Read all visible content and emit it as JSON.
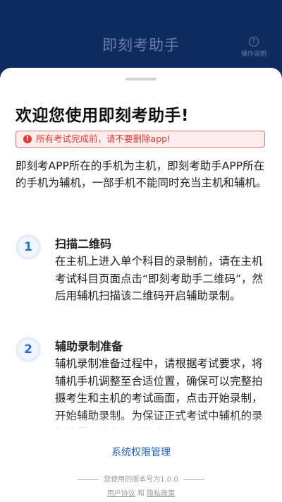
{
  "header": {
    "title": "即刻考助手",
    "help_label": "操作说明",
    "help_icon": "question-circle-icon"
  },
  "sheet": {
    "welcome": "欢迎您使用即刻考助手!",
    "alert": {
      "text": "所有考试完成前，请不要删除app!",
      "icon": "alert-circle-icon",
      "color": "#e53935"
    },
    "intro": "即刻考APP所在的手机为主机，即刻考助手APP所在的手机为辅机，一部手机不能同时充当主机和辅机。",
    "steps": [
      {
        "number": "1",
        "title": "扫描二维码",
        "body": "在主机上进入单个科目的录制前，请在主机考试科目页面点击“即刻考助手二维码”，然后用辅机扫描该二维码开启辅助录制。"
      },
      {
        "number": "2",
        "title": "辅助录制准备",
        "body": "辅机录制准备过程中，请根据考试要求，将辅机手机调整至合适位置，确保可以完整拍摄考生和主机的考试画面，点击开始录制，开始辅助录制。为保证正式考试中辅机的录制效果，请务必进行多次"
      }
    ]
  },
  "footer": {
    "permission_link": "系统权限管理",
    "version_text": "您使用的版本号为1.0.0",
    "user_agreement": "用户协议",
    "and": "和",
    "privacy_policy": "隐私政策"
  },
  "colors": {
    "header_bg": "#0e2b60",
    "accent": "#2463c4",
    "step_number": "#1e6fd9"
  }
}
